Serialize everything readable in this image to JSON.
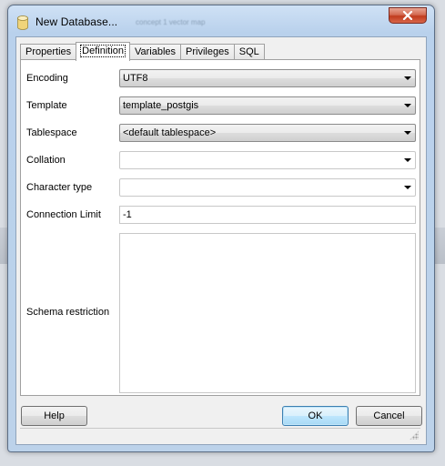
{
  "window": {
    "title": "New Database...",
    "ghost_title": "concept 1 vector map",
    "close_icon": "close-icon"
  },
  "tabs": [
    {
      "label": "Properties",
      "active": false
    },
    {
      "label": "Definition",
      "active": true
    },
    {
      "label": "Variables",
      "active": false
    },
    {
      "label": "Privileges",
      "active": false
    },
    {
      "label": "SQL",
      "active": false
    }
  ],
  "form": {
    "encoding": {
      "label": "Encoding",
      "value": "UTF8"
    },
    "template": {
      "label": "Template",
      "value": "template_postgis"
    },
    "tablespace": {
      "label": "Tablespace",
      "value": "<default tablespace>"
    },
    "collation": {
      "label": "Collation",
      "value": ""
    },
    "character_type": {
      "label": "Character type",
      "value": ""
    },
    "connection_limit": {
      "label": "Connection Limit",
      "value": "-1"
    },
    "schema_restriction": {
      "label": "Schema restriction",
      "value": ""
    }
  },
  "buttons": {
    "help": "Help",
    "ok": "OK",
    "cancel": "Cancel"
  },
  "colors": {
    "close_button": "#c13b1d",
    "default_button_border": "#3c7fb1"
  }
}
